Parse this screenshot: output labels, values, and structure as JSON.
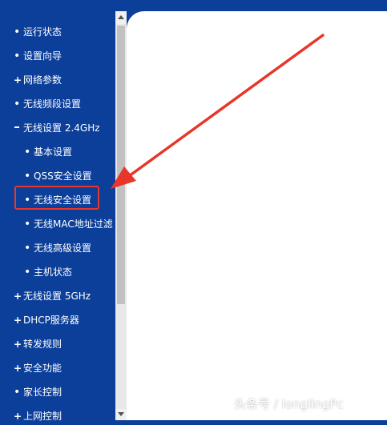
{
  "colors": {
    "nav_background": "#0c3f9a",
    "nav_text": "#ffffff",
    "content_background": "#ffffff",
    "highlight_border": "#e8362a",
    "arrow": "#e8362a",
    "scrollbar_track": "#e8e8e8",
    "scrollbar_thumb": "#c1c1c1"
  },
  "sidebar": {
    "items": [
      {
        "label": "运行状态",
        "marker": "dot-icon",
        "level": 0
      },
      {
        "label": "设置向导",
        "marker": "dot-icon",
        "level": 0
      },
      {
        "label": "网络参数",
        "marker": "plus-icon",
        "level": 0
      },
      {
        "label": "无线频段设置",
        "marker": "dot-icon",
        "level": 0
      },
      {
        "label": "无线设置 2.4GHz",
        "marker": "minus-icon",
        "level": 0
      },
      {
        "label": "基本设置",
        "marker": "dot-icon",
        "level": 1
      },
      {
        "label": "QSS安全设置",
        "marker": "dot-icon",
        "level": 1
      },
      {
        "label": "无线安全设置",
        "marker": "dot-icon",
        "level": 1,
        "highlighted": true
      },
      {
        "label": "无线MAC地址过滤",
        "marker": "dot-icon",
        "level": 1
      },
      {
        "label": "无线高级设置",
        "marker": "dot-icon",
        "level": 1
      },
      {
        "label": "主机状态",
        "marker": "dot-icon",
        "level": 1
      },
      {
        "label": "无线设置 5GHz",
        "marker": "plus-icon",
        "level": 0
      },
      {
        "label": "DHCP服务器",
        "marker": "plus-icon",
        "level": 0
      },
      {
        "label": "转发规则",
        "marker": "plus-icon",
        "level": 0
      },
      {
        "label": "安全功能",
        "marker": "plus-icon",
        "level": 0
      },
      {
        "label": "家长控制",
        "marker": "dot-icon",
        "level": 0
      },
      {
        "label": "上网控制",
        "marker": "plus-icon",
        "level": 0
      }
    ]
  },
  "watermark": {
    "text": "头条号 / longlingPc"
  }
}
